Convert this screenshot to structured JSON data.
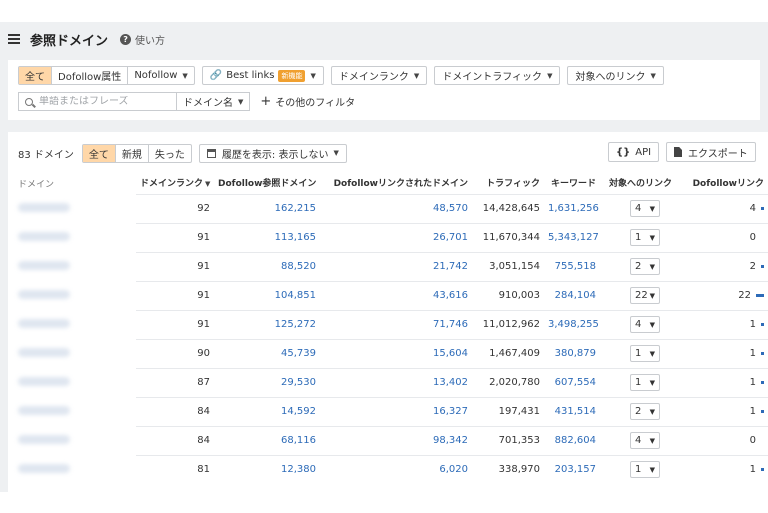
{
  "header": {
    "title": "参照ドメイン",
    "help_label": "使い方"
  },
  "filters": {
    "follow_tabs": [
      "全て",
      "Dofollow属性",
      "Nofollow"
    ],
    "best_links": {
      "label": "Best links",
      "badge": "新機能"
    },
    "dropdowns": [
      "ドメインランク",
      "ドメイントラフィック",
      "対象へのリンク"
    ],
    "search_placeholder": "単語またはフレーズ",
    "search_scope": "ドメイン名",
    "other_filters": "その他のフィルタ"
  },
  "results": {
    "count_label": "83 ドメイン",
    "status_tabs": [
      "全て",
      "新規",
      "失った"
    ],
    "history_label": "履歴を表示: 表示しない",
    "api_label": "API",
    "export_label": "エクスポート",
    "columns": [
      "ドメイン",
      "ドメインランク",
      "Dofollow参照ドメイン",
      "Dofollowリンクされたドメイン",
      "トラフィック",
      "キーワード",
      "対象へのリンク",
      "Dofollowリンク"
    ],
    "rows": [
      {
        "dr": "92",
        "ref": "162,215",
        "linked": "48,570",
        "traffic": "14,428,645",
        "kw": "1,631,256",
        "links": "4",
        "dofollow": "4"
      },
      {
        "dr": "91",
        "ref": "113,165",
        "linked": "26,701",
        "traffic": "11,670,344",
        "kw": "5,343,127",
        "links": "1",
        "dofollow": "0"
      },
      {
        "dr": "91",
        "ref": "88,520",
        "linked": "21,742",
        "traffic": "3,051,154",
        "kw": "755,518",
        "links": "2",
        "dofollow": "2"
      },
      {
        "dr": "91",
        "ref": "104,851",
        "linked": "43,616",
        "traffic": "910,003",
        "kw": "284,104",
        "links": "22",
        "dofollow": "22"
      },
      {
        "dr": "91",
        "ref": "125,272",
        "linked": "71,746",
        "traffic": "11,012,962",
        "kw": "3,498,255",
        "links": "4",
        "dofollow": "1"
      },
      {
        "dr": "90",
        "ref": "45,739",
        "linked": "15,604",
        "traffic": "1,467,409",
        "kw": "380,879",
        "links": "1",
        "dofollow": "1"
      },
      {
        "dr": "87",
        "ref": "29,530",
        "linked": "13,402",
        "traffic": "2,020,780",
        "kw": "607,554",
        "links": "1",
        "dofollow": "1"
      },
      {
        "dr": "84",
        "ref": "14,592",
        "linked": "16,327",
        "traffic": "197,431",
        "kw": "431,514",
        "links": "2",
        "dofollow": "1"
      },
      {
        "dr": "84",
        "ref": "68,116",
        "linked": "98,342",
        "traffic": "701,353",
        "kw": "882,604",
        "links": "4",
        "dofollow": "0"
      },
      {
        "dr": "81",
        "ref": "12,380",
        "linked": "6,020",
        "traffic": "338,970",
        "kw": "203,157",
        "links": "1",
        "dofollow": "1"
      }
    ]
  },
  "colors": {
    "accent": "#ffd7a8",
    "link": "#2d6bb8",
    "badge": "#f0a030"
  }
}
